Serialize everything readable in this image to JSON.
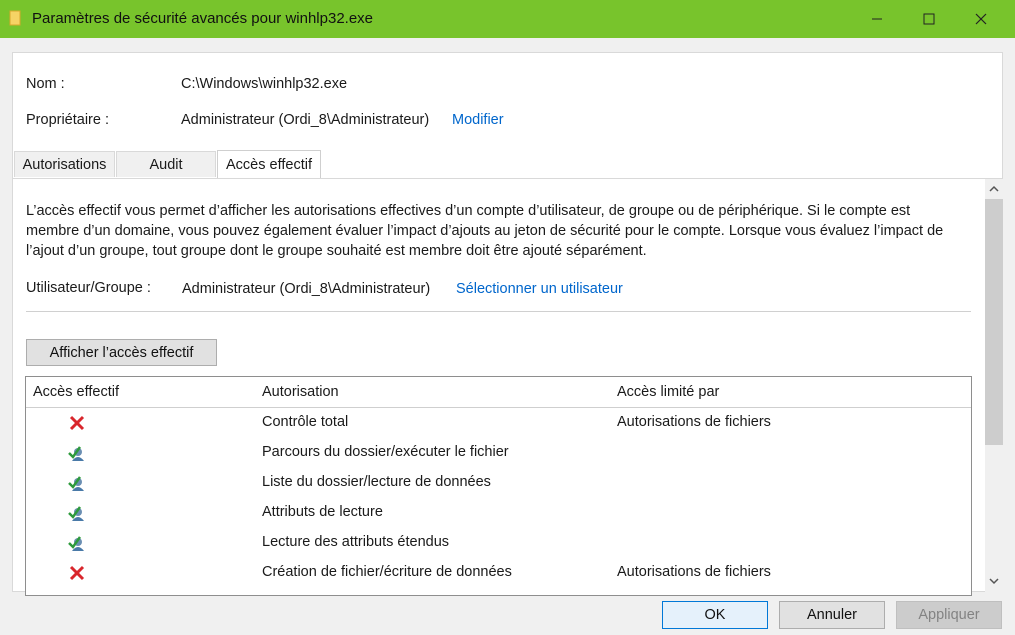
{
  "window": {
    "title": "Paramètres de sécurité avancés pour winhlp32.exe",
    "titlebar_color": "#78c42c"
  },
  "header": {
    "name_label": "Nom :",
    "name_value": "C:\\Windows\\winhlp32.exe",
    "owner_label": "Propriétaire :",
    "owner_value": "Administrateur (Ordi_8\\Administrateur)",
    "owner_change_link": "Modifier"
  },
  "tabs": [
    {
      "label": "Autorisations",
      "active": false
    },
    {
      "label": "Audit",
      "active": false
    },
    {
      "label": "Accès effectif",
      "active": true
    }
  ],
  "effective": {
    "description": "L’accès effectif vous permet d’afficher les autorisations effectives d’un compte d’utilisateur, de groupe ou de périphérique. Si le compte est membre d’un domaine, vous pouvez également évaluer l’impact d’ajouts au jeton de sécurité pour le compte. Lorsque vous évaluez l’impact de l’ajout d’un groupe, tout groupe dont le groupe souhaité est membre doit être ajouté séparément.",
    "user_group_label": "Utilisateur/Groupe :",
    "user_group_value": "Administrateur (Ordi_8\\Administrateur)",
    "select_user_link": "Sélectionner un utilisateur",
    "show_button": "Afficher l’accès effectif"
  },
  "table": {
    "columns": [
      "Accès effectif",
      "Autorisation",
      "Accès limité par"
    ],
    "rows": [
      {
        "access": "denied-x-icon",
        "permission": "Contrôle total",
        "limited_by": "Autorisations de fichiers"
      },
      {
        "access": "allowed-user-check-icon",
        "permission": "Parcours du dossier/exécuter le fichier",
        "limited_by": ""
      },
      {
        "access": "allowed-user-check-icon",
        "permission": "Liste du dossier/lecture de données",
        "limited_by": ""
      },
      {
        "access": "allowed-user-check-icon",
        "permission": "Attributs de lecture",
        "limited_by": ""
      },
      {
        "access": "allowed-user-check-icon",
        "permission": "Lecture des attributs étendus",
        "limited_by": ""
      },
      {
        "access": "denied-x-icon",
        "permission": "Création de fichier/écriture de données",
        "limited_by": "Autorisations de fichiers"
      }
    ]
  },
  "footer": {
    "ok": "OK",
    "cancel": "Annuler",
    "apply": "Appliquer"
  },
  "colors": {
    "link": "#0066cc",
    "deny": "#d9262c",
    "allow_check": "#2e9a3c"
  }
}
